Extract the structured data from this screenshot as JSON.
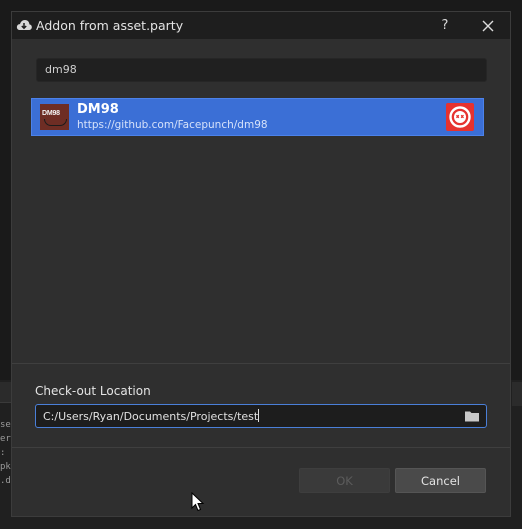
{
  "window": {
    "title": "Addon from asset.party",
    "help_label": "?",
    "title_icon": "cloud-download-icon",
    "close_icon": "close-icon"
  },
  "search": {
    "value": "dm98",
    "icon": "none"
  },
  "results": [
    {
      "name": "DM98",
      "url": "https://github.com/Facepunch/dm98",
      "thumbnail_text": "DM98",
      "badge_icon": "addon-badge-icon"
    }
  ],
  "checkout": {
    "label": "Check-out Location",
    "path": "C:/Users/Ryan/Documents/Projects/test",
    "browse_icon": "folder-icon"
  },
  "buttons": {
    "ok": "OK",
    "cancel": "Cancel"
  },
  "background_fragments": {
    "code_lines": [
      "se",
      "er",
      ":",
      "pk",
      ".d"
    ]
  },
  "colors": {
    "selection": "#3b6fd6",
    "badge": "#e6322f",
    "focus_border": "#4a7fd8",
    "dialog_bg": "#2f2f2f",
    "title_bg": "#1e1e1e"
  }
}
